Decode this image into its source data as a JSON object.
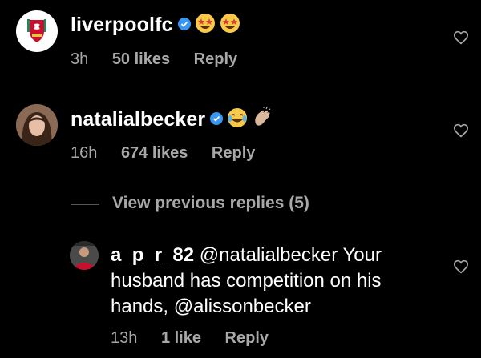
{
  "comments": [
    {
      "username": "liverpoolfc",
      "verified": true,
      "emojis": [
        "star-struck-emoji",
        "star-struck-emoji"
      ],
      "time": "3h",
      "likes": "50 likes",
      "reply_label": "Reply"
    },
    {
      "username": "natalialbecker",
      "verified": true,
      "emojis": [
        "tears-of-joy-emoji",
        "clapping-hands-emoji"
      ],
      "time": "16h",
      "likes": "674 likes",
      "reply_label": "Reply"
    }
  ],
  "view_previous": "View previous replies (5)",
  "reply": {
    "username": "a_p_r_82",
    "text": " @natalialbecker Your husband has competition on his hands, @alissonbecker",
    "time": "13h",
    "likes": "1 like",
    "reply_label": "Reply"
  },
  "colors": {
    "background": "#000000",
    "muted": "#a8a8a8",
    "verified": "#3897f0",
    "lfc_red": "#c8102e"
  },
  "icons": {
    "like": "heart-outline-icon",
    "verified": "verified-badge-icon"
  }
}
